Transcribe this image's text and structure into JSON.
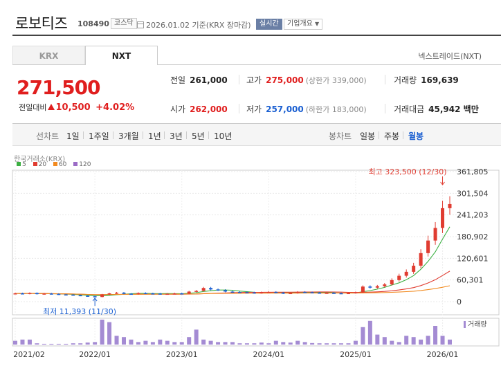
{
  "header": {
    "name": "로보티즈",
    "code": "108490",
    "market": "코스닥",
    "date": "2026.01.02",
    "basis": "기준(KRX 장마감)",
    "realtime": "실시간",
    "company_info": "기업개요"
  },
  "tabs": {
    "krx": "KRX",
    "nxt": "NXT",
    "nxt_link": "넥스트레이드(NXT)"
  },
  "quote": {
    "price": "271,500",
    "change_label": "전일대비",
    "change": "10,500",
    "change_pct": "+4.02%"
  },
  "stats": {
    "prev_close_label": "전일",
    "prev_close": "261,000",
    "high_label": "고가",
    "high": "275,000",
    "upper_limit": "(상한가 339,000)",
    "volume_label": "거래량",
    "volume": "169,639",
    "open_label": "시가",
    "open": "262,000",
    "low_label": "저가",
    "low": "257,000",
    "lower_limit": "(하한가 183,000)",
    "amount_label": "거래대금",
    "amount": "45,942 백만"
  },
  "periods": {
    "line_label": "선차트",
    "items": [
      "1일",
      "1주일",
      "3개월",
      "1년",
      "3년",
      "5년",
      "10년"
    ],
    "candle_label": "봉차트",
    "candles": [
      "일봉",
      "주봉",
      "월봉"
    ],
    "selected_candle": "월봉"
  },
  "chart_data": {
    "type": "candlestick",
    "source": "한국거래소(KRX)",
    "legend": [
      {
        "name": "5",
        "color": "#3cb043"
      },
      {
        "name": "20",
        "color": "#e03c31"
      },
      {
        "name": "60",
        "color": "#f28a1f"
      },
      {
        "name": "120",
        "color": "#9b6bc6"
      }
    ],
    "y_ticks": [
      "361,805",
      "301,504",
      "241,203",
      "180,902",
      "120,601",
      "60,301",
      "0"
    ],
    "x_ticks": [
      "2021/02",
      "2022/01",
      "2023/01",
      "2024/01",
      "2025/01",
      "2026/01"
    ],
    "ylim": [
      0,
      361805
    ],
    "max_annotation": "최고 323,500 (12/30)",
    "min_annotation": "최저 11,393 (11/30)",
    "volume_label": "거래량",
    "months": 60,
    "closes": [
      23000,
      22000,
      24000,
      21000,
      22500,
      21500,
      20000,
      19500,
      18000,
      16500,
      15000,
      13000,
      20000,
      23000,
      25000,
      22000,
      21000,
      24000,
      23000,
      22500,
      21000,
      22000,
      23000,
      22000,
      28000,
      30000,
      38000,
      34000,
      32000,
      28000,
      27000,
      26000,
      25500,
      24000,
      26000,
      27000,
      25000,
      23000,
      24000,
      27000,
      26000,
      25000,
      24000,
      24500,
      23500,
      23000,
      24000,
      26000,
      42000,
      39000,
      43000,
      48000,
      60000,
      72000,
      83000,
      100000,
      135000,
      170000,
      205000,
      260000,
      271500
    ],
    "volumes": [
      0.15,
      0.2,
      0.2,
      0.05,
      0.03,
      0.03,
      0.03,
      0.03,
      0.05,
      0.05,
      0.08,
      0.1,
      1.0,
      0.9,
      0.35,
      0.3,
      0.2,
      0.1,
      0.15,
      0.1,
      0.2,
      0.15,
      0.1,
      0.1,
      0.3,
      0.6,
      0.2,
      0.15,
      0.1,
      0.1,
      0.1,
      0.05,
      0.05,
      0.05,
      0.08,
      0.05,
      0.15,
      0.1,
      0.08,
      0.15,
      0.1,
      0.06,
      0.05,
      0.05,
      0.05,
      0.05,
      0.05,
      0.15,
      0.7,
      0.95,
      0.4,
      0.3,
      0.15,
      0.1,
      0.35,
      0.3,
      0.2,
      0.35,
      0.75,
      0.35,
      0.2
    ]
  }
}
